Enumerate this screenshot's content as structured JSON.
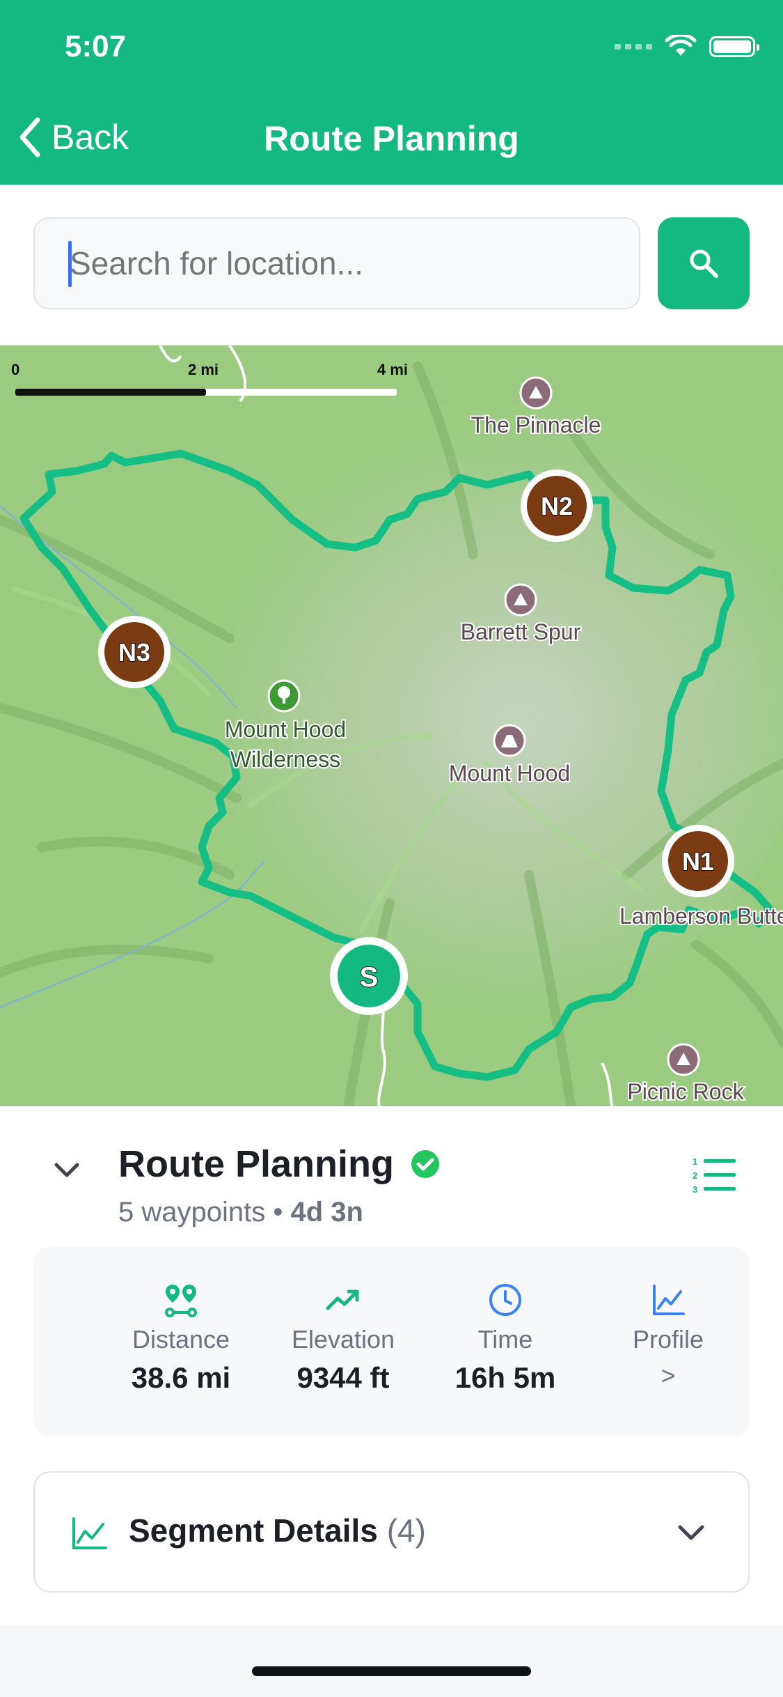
{
  "status": {
    "time": "5:07"
  },
  "header": {
    "back_label": "Back",
    "title": "Route Planning"
  },
  "search": {
    "placeholder": "Search for location..."
  },
  "map": {
    "scale": {
      "zero": "0",
      "mid": "2 mi",
      "max": "4 mi"
    },
    "places": {
      "pinnacle": "The Pinnacle",
      "barrett": "Barrett Spur",
      "hood": "Mount Hood",
      "wilderness_1": "Mount Hood",
      "wilderness_2": "Wilderness",
      "lamberson": "Lamberson Butte",
      "picnic": "Picnic Rock"
    },
    "waypoints": {
      "n1": "N1",
      "n2": "N2",
      "n3": "N3",
      "start": "S"
    },
    "colors": {
      "route": "#15be84",
      "waypoint": "#7a3a12",
      "start": "#13b981"
    }
  },
  "route": {
    "title": "Route Planning",
    "waypoints_text": "5 waypoints",
    "separator": "•",
    "duration": "4d 3n"
  },
  "stats": [
    {
      "label": "Distance",
      "value": "38.6 mi",
      "icon": "route-pins-icon"
    },
    {
      "label": "Elevation",
      "value": "9344 ft",
      "icon": "trending-up-icon"
    },
    {
      "label": "Time",
      "value": "16h 5m",
      "icon": "clock-icon"
    },
    {
      "label": "Profile",
      "value": ">",
      "icon": "chart-line-icon"
    }
  ],
  "segments": {
    "title": "Segment Details",
    "count": "(4)"
  },
  "colors": {
    "brand": "#13b981",
    "blue": "#3b82f6"
  }
}
